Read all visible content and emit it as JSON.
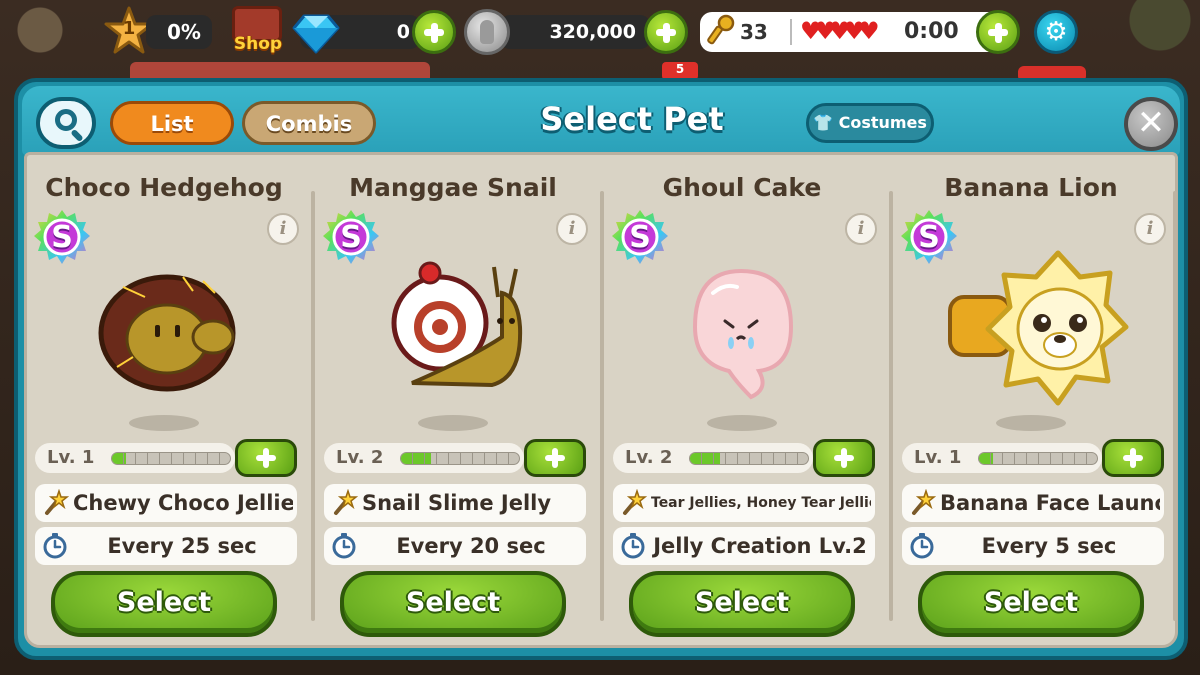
{
  "hud": {
    "level": "1",
    "progress_text": "0%",
    "shop_label": "Shop",
    "gems": "0",
    "coins": "320,000",
    "keys": "33",
    "hearts": "♥♥♥♥♥",
    "timer": "0:00"
  },
  "background": {
    "badge_text": "5"
  },
  "dialog": {
    "title": "Select Pet",
    "tabs": [
      {
        "label": "List",
        "active": true
      },
      {
        "label": "Combis",
        "active": false
      }
    ],
    "costumes_label": "Costumes",
    "close_label": "✕"
  },
  "pets": [
    {
      "name": "Choco Hedgehog",
      "rank": "S",
      "level_text": "Lv. 1",
      "xp_fraction": 0.12,
      "skill": "Chewy Choco Jellies",
      "interval": "Every 25 sec",
      "select_label": "Select"
    },
    {
      "name": "Manggae Snail",
      "rank": "S",
      "level_text": "Lv. 2",
      "xp_fraction": 0.25,
      "skill": "Snail Slime Jelly",
      "interval": "Every 20 sec",
      "select_label": "Select"
    },
    {
      "name": "Ghoul Cake",
      "rank": "S",
      "level_text": "Lv. 2",
      "xp_fraction": 0.25,
      "skill": "Tear Jellies, Honey Tear Jellies",
      "interval": "Jelly Creation Lv.2",
      "select_label": "Select"
    },
    {
      "name": "Banana Lion",
      "rank": "S",
      "level_text": "Lv. 1",
      "xp_fraction": 0.12,
      "skill": "Banana Face Launch",
      "interval": "Every 5 sec",
      "select_label": "Select"
    }
  ],
  "colors": {
    "accent": "#1d8fa6",
    "select_green": "#6cc82a",
    "tab_active": "#f08a1e",
    "tab_inactive": "#c9a774"
  }
}
